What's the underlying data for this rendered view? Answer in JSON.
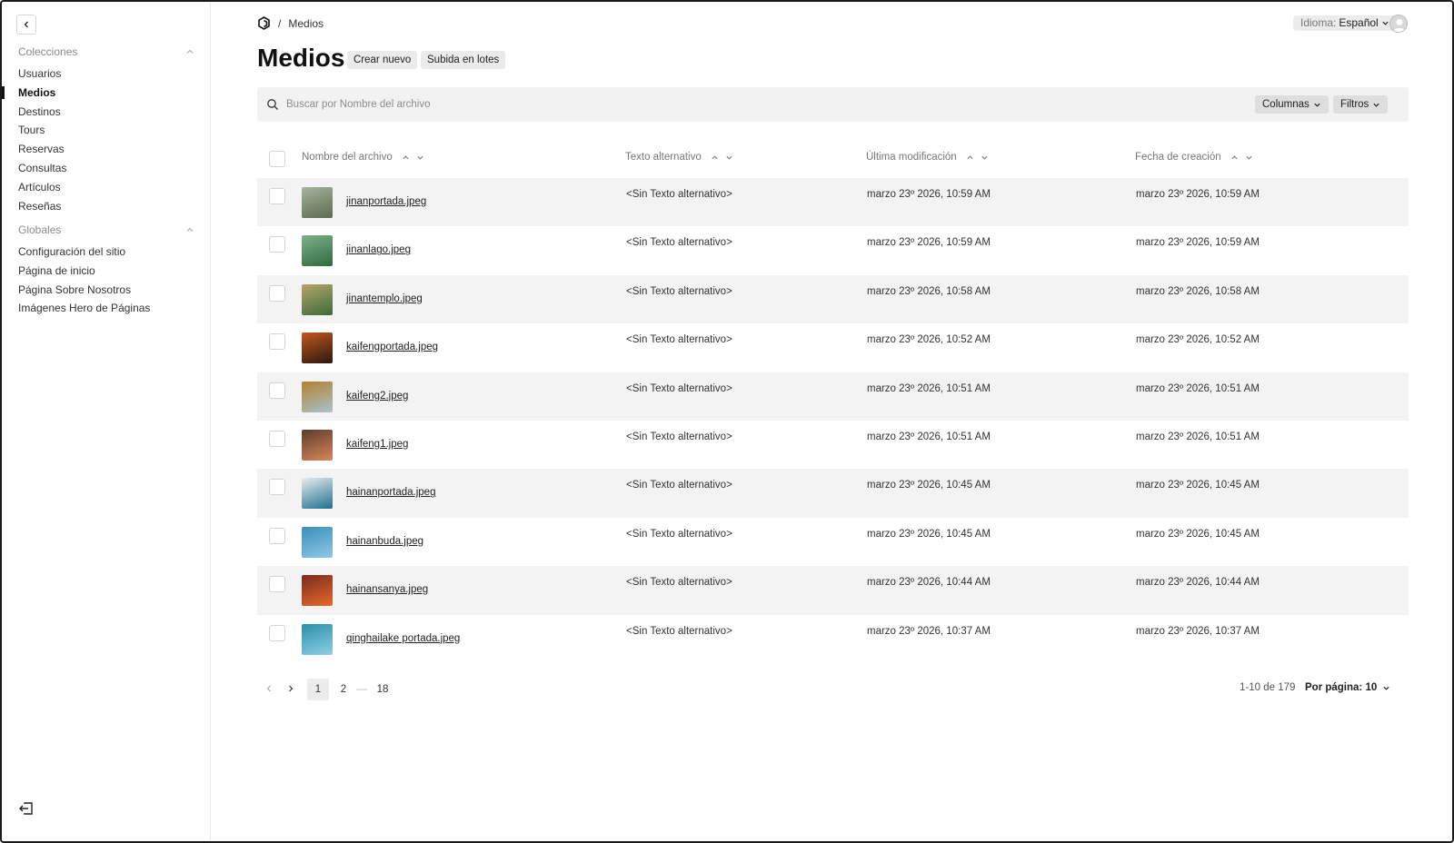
{
  "sidebar": {
    "groups": [
      {
        "title": "Colecciones",
        "items": [
          "Usuarios",
          "Medios",
          "Destinos",
          "Tours",
          "Reservas",
          "Consultas",
          "Artículos",
          "Reseñas"
        ]
      },
      {
        "title": "Globales",
        "items": [
          "Configuración del sitio",
          "Página de inicio",
          "Página Sobre Nosotros",
          "Imágenes Hero de Páginas"
        ]
      }
    ],
    "active_item": "Medios"
  },
  "header": {
    "breadcrumb_separator": "/",
    "breadcrumb_current": "Medios",
    "language_label": "Idioma:",
    "language_value": "Español"
  },
  "page": {
    "title": "Medios",
    "create_label": "Crear nuevo",
    "bulk_upload_label": "Subida en lotes"
  },
  "search": {
    "placeholder": "Buscar por Nombre del archivo",
    "columns_label": "Columnas",
    "filters_label": "Filtros"
  },
  "table": {
    "columns": [
      "Nombre del archivo",
      "Texto alternativo",
      "Última modificación",
      "Fecha de creación"
    ],
    "rows": [
      {
        "filename": "jinanportada.jpeg",
        "alt": "<Sin Texto alternativo>",
        "modified": "marzo 23º 2026, 10:59 AM",
        "created": "marzo 23º 2026, 10:59 AM",
        "thumb_colors": [
          "#5b6b4a",
          "#a7b3a1"
        ]
      },
      {
        "filename": "jinanlago.jpeg",
        "alt": "<Sin Texto alternativo>",
        "modified": "marzo 23º 2026, 10:59 AM",
        "created": "marzo 23º 2026, 10:59 AM",
        "thumb_colors": [
          "#2f6b3d",
          "#7fb08a"
        ]
      },
      {
        "filename": "jinantemplo.jpeg",
        "alt": "<Sin Texto alternativo>",
        "modified": "marzo 23º 2026, 10:58 AM",
        "created": "marzo 23º 2026, 10:58 AM",
        "thumb_colors": [
          "#3d6a3a",
          "#b3a56a"
        ]
      },
      {
        "filename": "kaifengportada.jpeg",
        "alt": "<Sin Texto alternativo>",
        "modified": "marzo 23º 2026, 10:52 AM",
        "created": "marzo 23º 2026, 10:52 AM",
        "thumb_colors": [
          "#2a1710",
          "#c4571e"
        ]
      },
      {
        "filename": "kaifeng2.jpeg",
        "alt": "<Sin Texto alternativo>",
        "modified": "marzo 23º 2026, 10:51 AM",
        "created": "marzo 23º 2026, 10:51 AM",
        "thumb_colors": [
          "#a9c3cf",
          "#b2812f"
        ]
      },
      {
        "filename": "kaifeng1.jpeg",
        "alt": "<Sin Texto alternativo>",
        "modified": "marzo 23º 2026, 10:51 AM",
        "created": "marzo 23º 2026, 10:51 AM",
        "thumb_colors": [
          "#d9875a",
          "#5e3b2c"
        ]
      },
      {
        "filename": "hainanportada.jpeg",
        "alt": "<Sin Texto alternativo>",
        "modified": "marzo 23º 2026, 10:45 AM",
        "created": "marzo 23º 2026, 10:45 AM",
        "thumb_colors": [
          "#1e6f8f",
          "#e9edf0"
        ]
      },
      {
        "filename": "hainanbuda.jpeg",
        "alt": "<Sin Texto alternativo>",
        "modified": "marzo 23º 2026, 10:45 AM",
        "created": "marzo 23º 2026, 10:45 AM",
        "thumb_colors": [
          "#8fc8e8",
          "#3a8fb8"
        ]
      },
      {
        "filename": "hainansanya.jpeg",
        "alt": "<Sin Texto alternativo>",
        "modified": "marzo 23º 2026, 10:44 AM",
        "created": "marzo 23º 2026, 10:44 AM",
        "thumb_colors": [
          "#e56a2e",
          "#7b2b1c"
        ]
      },
      {
        "filename": "qinghailake portada.jpeg",
        "alt": "<Sin Texto alternativo>",
        "modified": "marzo 23º 2026, 10:37 AM",
        "created": "marzo 23º 2026, 10:37 AM",
        "thumb_colors": [
          "#8fd0e6",
          "#2a8fa8"
        ]
      }
    ]
  },
  "pagination": {
    "pages": [
      "1",
      "2",
      "18"
    ],
    "ellipsis": "—",
    "current": "1",
    "range_text": "1-10 de 179",
    "per_page_label": "Por página: 10"
  },
  "colors": {
    "row_shade": "#f3f3f3",
    "pill": "#ebebeb",
    "search_bg": "#f2f2f2"
  }
}
